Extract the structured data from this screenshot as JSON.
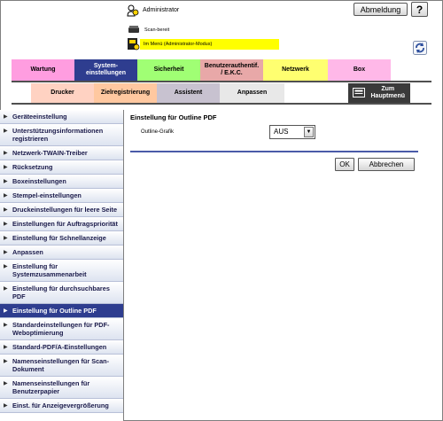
{
  "header": {
    "user_label": "Administrator",
    "logout_label": "Abmeldung",
    "help_label": "?",
    "scan_status": "Scan-bereit",
    "mode_status": "Im Menü (Administrator-Modus)"
  },
  "tabs_row1": [
    {
      "label": "Wartung",
      "color": "#ff9de0"
    },
    {
      "label": "System-\neinstellungen",
      "color": "#2e3d8f"
    },
    {
      "label": "Sicherheit",
      "color": "#a0ff74"
    },
    {
      "label": "Benutzerauthentif. / E.K.C.",
      "color": "#e8a8a8"
    },
    {
      "label": "Netzwerk",
      "color": "#ffff70"
    },
    {
      "label": "Box",
      "color": "#ffb8e8"
    }
  ],
  "tabs_row2": [
    {
      "label": "Drucker",
      "color": "#ffd2c2"
    },
    {
      "label": "Zielregistrierung",
      "color": "#ffc8a0"
    },
    {
      "label": "Assistent",
      "color": "#c8c2d0"
    },
    {
      "label": "Anpassen",
      "color": "#e8e8e8"
    }
  ],
  "home_button": {
    "label": "Zum\nHauptmenü"
  },
  "sidebar": {
    "items": [
      {
        "label": "Geräteeinstellung"
      },
      {
        "label": "Unterstützungsinformationen registrieren"
      },
      {
        "label": "Netzwerk-TWAIN-Treiber"
      },
      {
        "label": "Rücksetzung"
      },
      {
        "label": "Boxeinstellungen"
      },
      {
        "label": "Stempel-einstellungen"
      },
      {
        "label": "Druckeinstellungen für leere Seite"
      },
      {
        "label": "Einstellungen für Auftragspriorität"
      },
      {
        "label": "Einstellung für Schnellanzeige"
      },
      {
        "label": "Anpassen"
      },
      {
        "label": "Einstellung für Systemzusammenarbeit"
      },
      {
        "label": "Einstellung für durchsuchbares PDF"
      },
      {
        "label": "Einstellung für Outline PDF",
        "active": true
      },
      {
        "label": "Standardeinstellungen für PDF-Weboptimierung"
      },
      {
        "label": "Standard-PDF/A-Einstellungen"
      },
      {
        "label": "Namenseinstellungen für Scan-Dokument"
      },
      {
        "label": "Namenseinstellungen für Benutzerpapier"
      },
      {
        "label": "Einst. für Anzeigevergrößerung"
      }
    ]
  },
  "main": {
    "title": "Einstellung für Outline PDF",
    "field_label": "Outline-Grafik",
    "select_value": "AUS",
    "ok_label": "OK",
    "cancel_label": "Abbrechen"
  }
}
